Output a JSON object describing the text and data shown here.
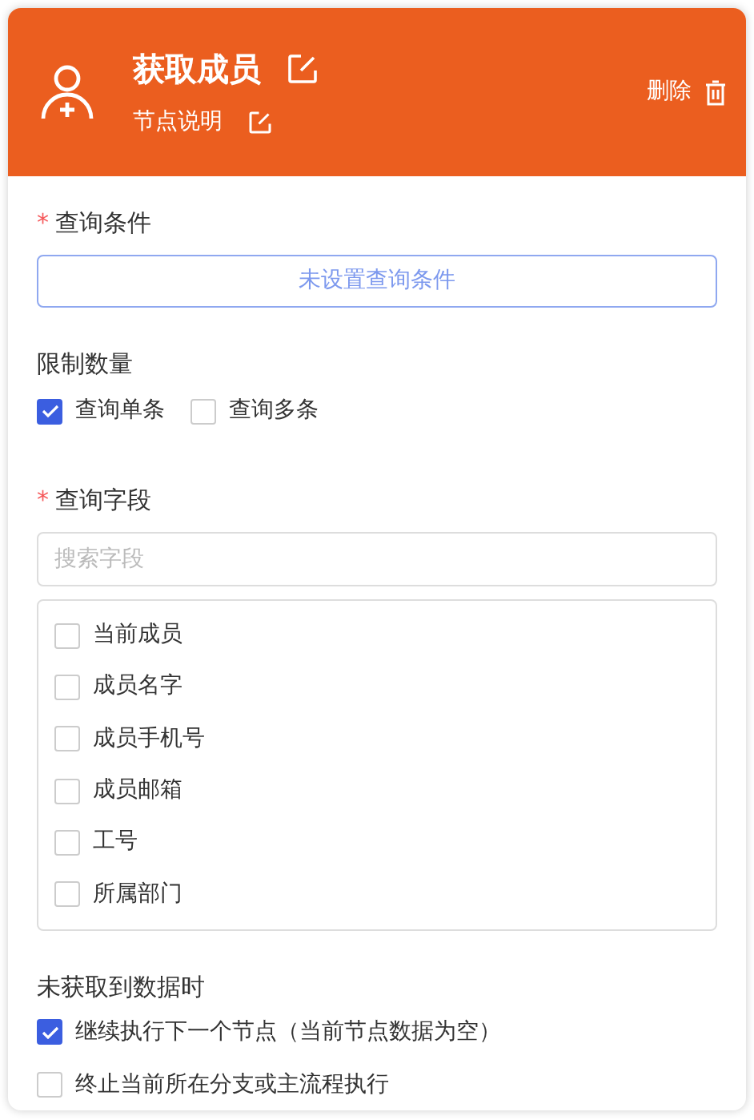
{
  "header": {
    "title": "获取成员",
    "description": "节点说明",
    "delete": "删除"
  },
  "condition": {
    "label": "查询条件",
    "required_mark": "*",
    "button": "未设置查询条件"
  },
  "limit": {
    "label": "限制数量",
    "options": [
      {
        "label": "查询单条",
        "checked": true
      },
      {
        "label": "查询多条",
        "checked": false
      }
    ]
  },
  "fields": {
    "label": "查询字段",
    "required_mark": "*",
    "search_placeholder": "搜索字段",
    "items": [
      {
        "label": "当前成员",
        "checked": false
      },
      {
        "label": "成员名字",
        "checked": false
      },
      {
        "label": "成员手机号",
        "checked": false
      },
      {
        "label": "成员邮箱",
        "checked": false
      },
      {
        "label": "工号",
        "checked": false
      },
      {
        "label": "所属部门",
        "checked": false
      }
    ]
  },
  "no_data": {
    "label": "未获取到数据时",
    "options": [
      {
        "label": "继续执行下一个节点（当前节点数据为空）",
        "checked": true
      },
      {
        "label": "终止当前所在分支或主流程执行",
        "checked": false
      }
    ]
  }
}
